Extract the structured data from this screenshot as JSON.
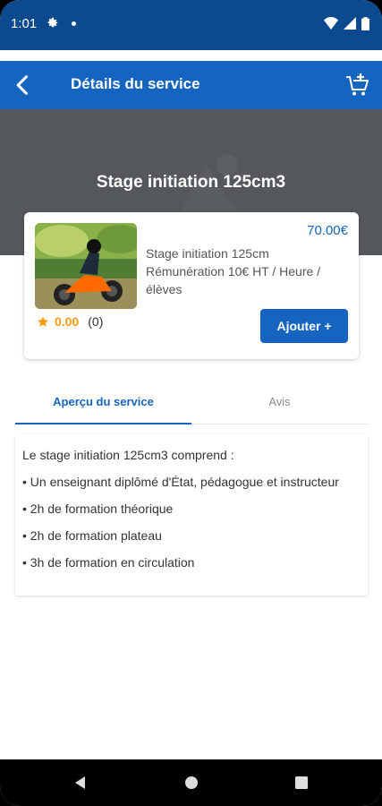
{
  "status_bar": {
    "time": "1:01"
  },
  "app_bar": {
    "title": "Détails du service"
  },
  "hero": {
    "title": "Stage initiation 125cm3"
  },
  "card": {
    "price": "70.00€",
    "description_line1": "Stage initiation 125cm",
    "description_line2": "Rémunération 10€ HT / Heure /",
    "description_line3": "élèves",
    "rating_value": "0.00",
    "rating_count": "(0)",
    "add_button_label": "Ajouter +"
  },
  "tabs": [
    {
      "label": "Aperçu du service",
      "active": true
    },
    {
      "label": "Avis",
      "active": false
    }
  ],
  "description": {
    "lines": [
      "Le stage initiation 125cm3 comprend :",
      "• Un enseignant diplômé d'État, pédagogue et instructeur",
      "• 2h de formation théorique",
      "• 2h de formation plateau",
      "• 3h de formation en circulation"
    ]
  },
  "colors": {
    "primary": "#1565c0",
    "status_bar": "#0b4a8f",
    "hero_bg": "#54585c",
    "star": "#f39c12"
  },
  "icons": {
    "back": "arrow-back-icon",
    "cart": "cart-add-icon",
    "star": "star-icon"
  }
}
